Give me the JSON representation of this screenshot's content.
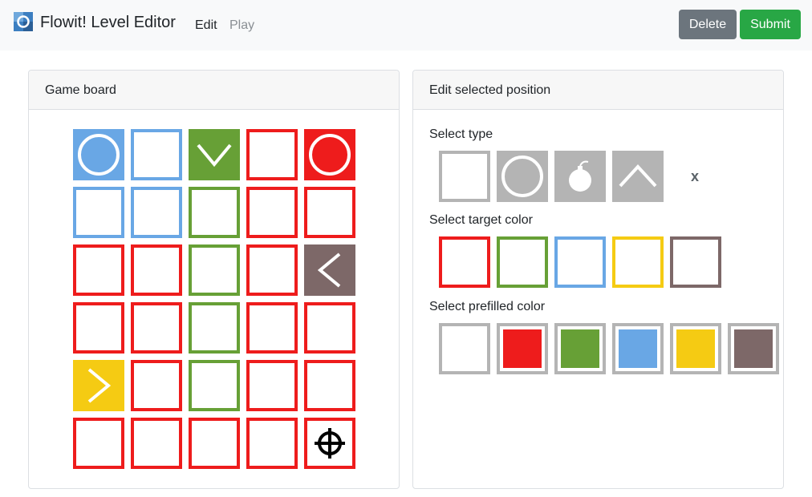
{
  "app": {
    "title": "Flowit! Level Editor",
    "logo_icon": "flowit-logo-icon"
  },
  "nav": {
    "edit_label": "Edit",
    "play_label": "Play",
    "active": "Edit"
  },
  "actions": {
    "delete_label": "Delete",
    "submit_label": "Submit"
  },
  "colors": {
    "red": "#ee1c1c",
    "green": "#67a036",
    "blue": "#69a7e5",
    "yellow": "#f5cb13",
    "brown": "#7d6868",
    "gray": "#b4b4b4",
    "delete_button": "#6c757d",
    "submit_button": "#28a745"
  },
  "board": {
    "title": "Game board",
    "cells": [
      [
        {
          "color": "blue",
          "fill": true,
          "icon": "circle-icon"
        },
        {
          "color": "blue",
          "fill": false,
          "icon": "none"
        },
        {
          "color": "green",
          "fill": true,
          "icon": "chevron-down-icon"
        },
        {
          "color": "red",
          "fill": false,
          "icon": "none"
        },
        {
          "color": "red",
          "fill": true,
          "icon": "circle-icon"
        }
      ],
      [
        {
          "color": "blue",
          "fill": false,
          "icon": "none"
        },
        {
          "color": "blue",
          "fill": false,
          "icon": "none"
        },
        {
          "color": "green",
          "fill": false,
          "icon": "none"
        },
        {
          "color": "red",
          "fill": false,
          "icon": "none"
        },
        {
          "color": "red",
          "fill": false,
          "icon": "none"
        }
      ],
      [
        {
          "color": "red",
          "fill": false,
          "icon": "none"
        },
        {
          "color": "red",
          "fill": false,
          "icon": "none"
        },
        {
          "color": "green",
          "fill": false,
          "icon": "none"
        },
        {
          "color": "red",
          "fill": false,
          "icon": "none"
        },
        {
          "color": "brown",
          "fill": true,
          "icon": "chevron-left-icon"
        }
      ],
      [
        {
          "color": "red",
          "fill": false,
          "icon": "none"
        },
        {
          "color": "red",
          "fill": false,
          "icon": "none"
        },
        {
          "color": "green",
          "fill": false,
          "icon": "none"
        },
        {
          "color": "red",
          "fill": false,
          "icon": "none"
        },
        {
          "color": "red",
          "fill": false,
          "icon": "none"
        }
      ],
      [
        {
          "color": "yellow",
          "fill": true,
          "icon": "chevron-right-icon"
        },
        {
          "color": "red",
          "fill": false,
          "icon": "none"
        },
        {
          "color": "green",
          "fill": false,
          "icon": "none"
        },
        {
          "color": "red",
          "fill": false,
          "icon": "none"
        },
        {
          "color": "red",
          "fill": false,
          "icon": "none"
        }
      ],
      [
        {
          "color": "red",
          "fill": false,
          "icon": "none"
        },
        {
          "color": "red",
          "fill": false,
          "icon": "none"
        },
        {
          "color": "red",
          "fill": false,
          "icon": "none"
        },
        {
          "color": "red",
          "fill": false,
          "icon": "none"
        },
        {
          "color": "red",
          "fill": false,
          "icon": "crosshair-icon"
        }
      ]
    ]
  },
  "editor": {
    "title": "Edit selected position",
    "type_label": "Select type",
    "types": [
      {
        "name": "empty",
        "icon": "empty-square-icon"
      },
      {
        "name": "circle",
        "icon": "circle-icon"
      },
      {
        "name": "bomb",
        "icon": "bomb-icon"
      },
      {
        "name": "arrow",
        "icon": "chevron-up-icon"
      }
    ],
    "clear_label": "x",
    "target_label": "Select target color",
    "target_colors": [
      "red",
      "green",
      "blue",
      "yellow",
      "brown"
    ],
    "prefilled_label": "Select prefilled color",
    "prefilled_colors": [
      "white",
      "red",
      "green",
      "blue",
      "yellow",
      "brown"
    ]
  }
}
